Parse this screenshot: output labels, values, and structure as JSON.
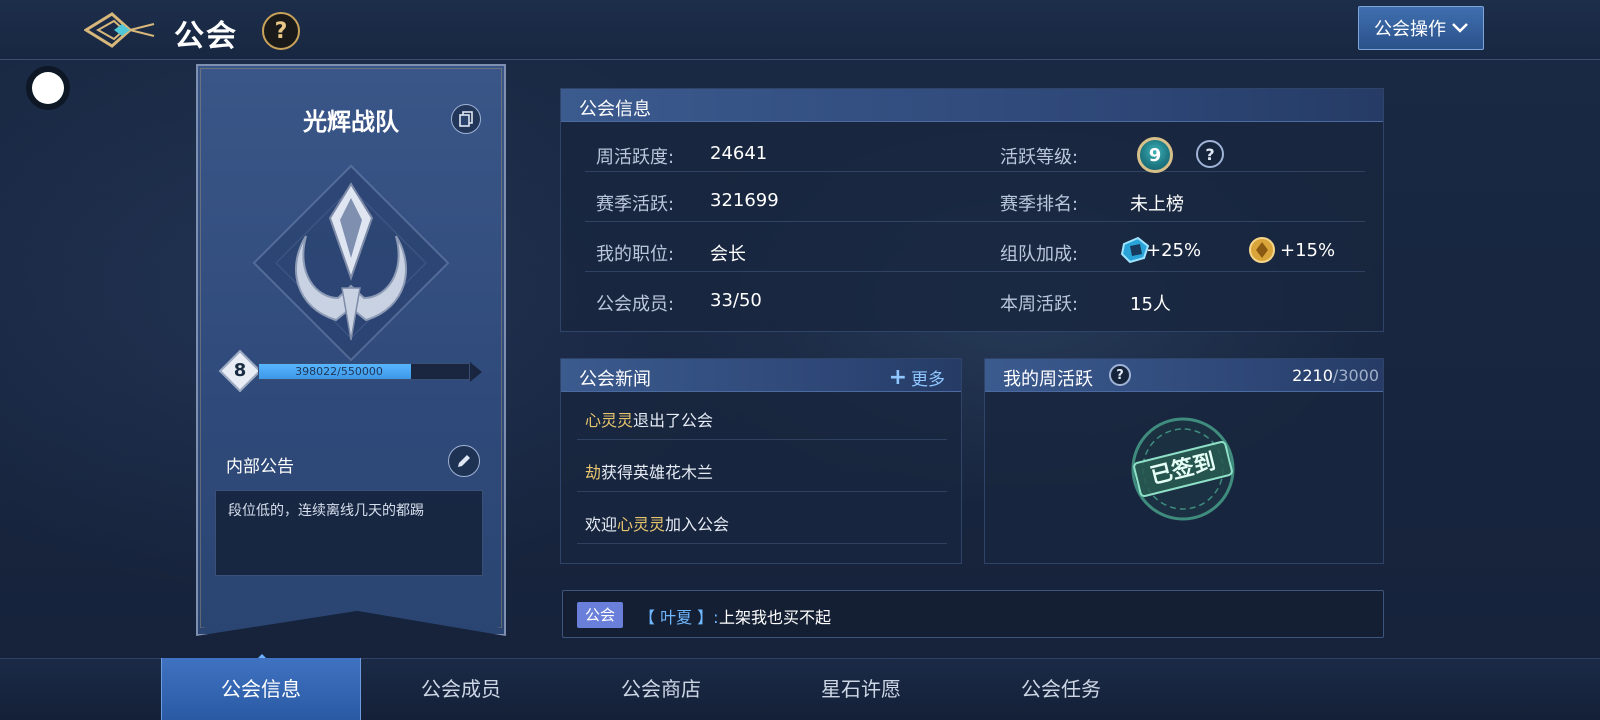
{
  "header": {
    "title": "公会",
    "help_label": "?",
    "guild_ops_label": "公会操作"
  },
  "guild": {
    "name": "光辉战队",
    "level": "8",
    "xp_text": "398022/550000",
    "xp_fraction": 0.7237,
    "notice_label": "内部公告",
    "notice_text": "段位低的，连续离线几天的都踢"
  },
  "info": {
    "title": "公会信息",
    "rows": [
      {
        "label": "周活跃度:",
        "value": "24641"
      },
      {
        "label": "赛季活跃:",
        "value": "321699"
      },
      {
        "label": "我的职位:",
        "value": "会长"
      },
      {
        "label": "公会成员:",
        "value": "33/50"
      }
    ],
    "right_rows": {
      "active_level_label": "活跃等级:",
      "active_level_value": "9",
      "season_rank_label": "赛季排名:",
      "season_rank_value": "未上榜",
      "team_bonus_label": "组队加成:",
      "bonus_1": "+25%",
      "bonus_2": "+15%",
      "weekly_active_label": "本周活跃:",
      "weekly_active_value": "15人"
    }
  },
  "news": {
    "title": "公会新闻",
    "more_label": "更多",
    "items": [
      {
        "highlight": "心灵灵",
        "text": "退出了公会"
      },
      {
        "highlight": "劫",
        "text": "获得英雄花木兰"
      },
      {
        "prefix": "欢迎",
        "highlight": "心灵灵",
        "text": "加入公会"
      }
    ]
  },
  "weekly": {
    "title": "我的周活跃",
    "current": "2210",
    "max": "/3000",
    "stamp_text": "已签到"
  },
  "chat": {
    "channel": "公会",
    "user": "【 叶夏 】:",
    "message": "上架我也买不起"
  },
  "tabs": [
    "公会信息",
    "公会成员",
    "公会商店",
    "星石许愿",
    "公会任务"
  ],
  "colors": {
    "accent_blue": "#3f72c1",
    "highlight_gold": "#e9c66e",
    "xp_fill": "#58b6ff",
    "channel_purple": "#6a7fd9"
  },
  "icons": [
    "back-wing-icon",
    "help-icon",
    "chevron-down-icon",
    "copy-icon",
    "guild-emblem-icon",
    "edit-pencil-icon",
    "plus-icon",
    "team-bonus-icon",
    "coin-bonus-icon",
    "signed-stamp-icon"
  ]
}
